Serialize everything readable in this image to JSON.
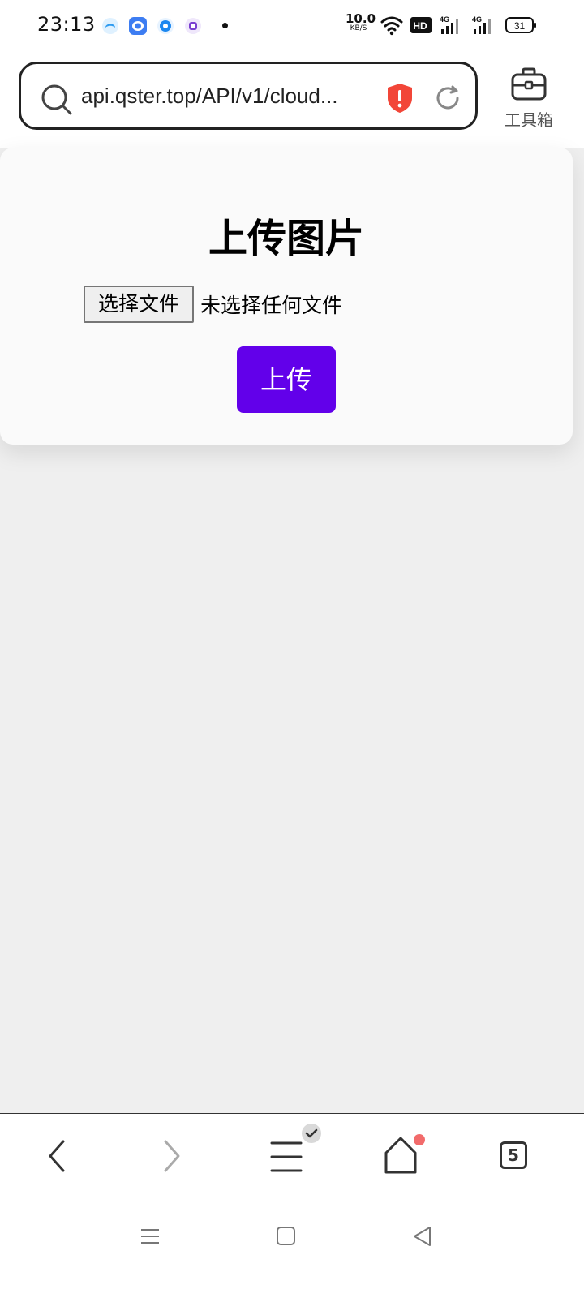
{
  "status_bar": {
    "time": "23:13",
    "net_speed_value": "10.0",
    "net_speed_unit": "KB/S",
    "hd_label": "HD",
    "signal_1": "4G",
    "signal_2": "4G",
    "battery": "31",
    "notification_icons": [
      "browser-app-icon",
      "chat-app-icon",
      "message-app-icon",
      "purple-app-icon"
    ]
  },
  "browser": {
    "url": "api.qster.top/API/v1/cloud...",
    "toolbox_label": "工具箱"
  },
  "page": {
    "title": "上传图片",
    "choose_file_label": "选择文件",
    "no_file_text": "未选择任何文件",
    "upload_label": "上传",
    "accent_color": "#6200ea"
  },
  "bottom_nav": {
    "tabs_count": "5"
  }
}
